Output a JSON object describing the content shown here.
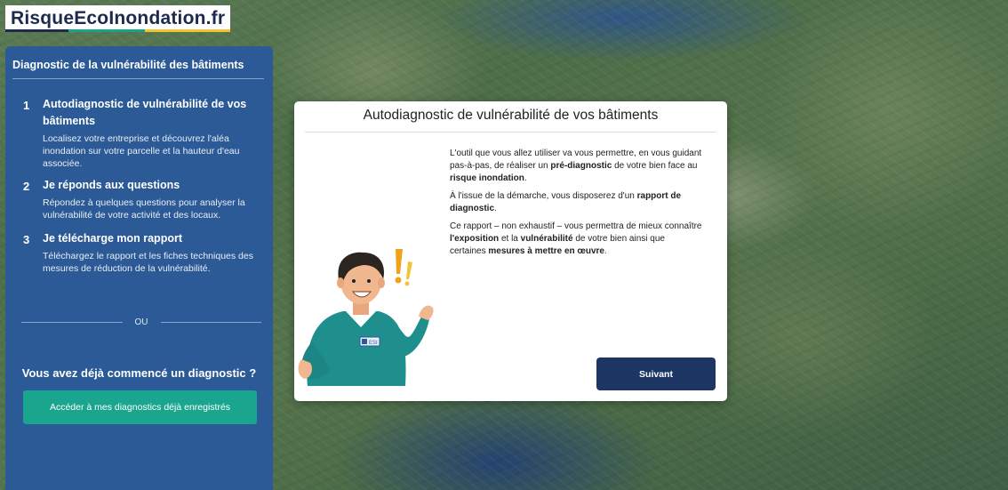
{
  "logo": {
    "text": "RisqueEcoInondation.fr"
  },
  "sidebar": {
    "title": "Diagnostic de la vulnérabilité des bâtiments",
    "steps": [
      {
        "num": "1",
        "title": "Autodiagnostic de vulnérabilité de vos bâtiments",
        "desc": "Localisez votre entreprise et découvrez l'aléa inondation sur votre parcelle et la hauteur d'eau associée."
      },
      {
        "num": "2",
        "title": "Je réponds aux questions",
        "desc": "Répondez à quelques questions pour analyser la vulnérabilité de votre activité et des locaux."
      },
      {
        "num": "3",
        "title": "Je télécharge mon rapport",
        "desc": "Téléchargez le rapport et les fiches techniques des mesures de réduction de la vulnérabilité."
      }
    ],
    "separator": "OU",
    "question": "Vous avez déjà commencé un diagnostic ?",
    "button": "Accéder à mes diagnostics déjà enregistrés"
  },
  "modal": {
    "title": "Autodiagnostic de vulnérabilité de vos bâtiments",
    "p1_a": "L'outil que vous allez utiliser va vous permettre, en vous guidant pas-à-pas, de réaliser un ",
    "p1_b": "pré-diagnostic",
    "p1_c": " de votre bien face au ",
    "p1_d": "risque inondation",
    "p1_e": ".",
    "p2_a": "À l'issue de la démarche, vous disposerez d'un ",
    "p2_b": "rapport de diagnostic",
    "p2_c": ".",
    "p3_a": "Ce rapport – non exhaustif – vous permettra de mieux connaître ",
    "p3_b": "l'exposition",
    "p3_c": " et la ",
    "p3_d": "vulnérabilité",
    "p3_e": " de votre bien ainsi que certaines ",
    "p3_f": "mesures à mettre en œuvre",
    "p3_g": ".",
    "button": "Suivant",
    "badge_text": "ESI"
  }
}
